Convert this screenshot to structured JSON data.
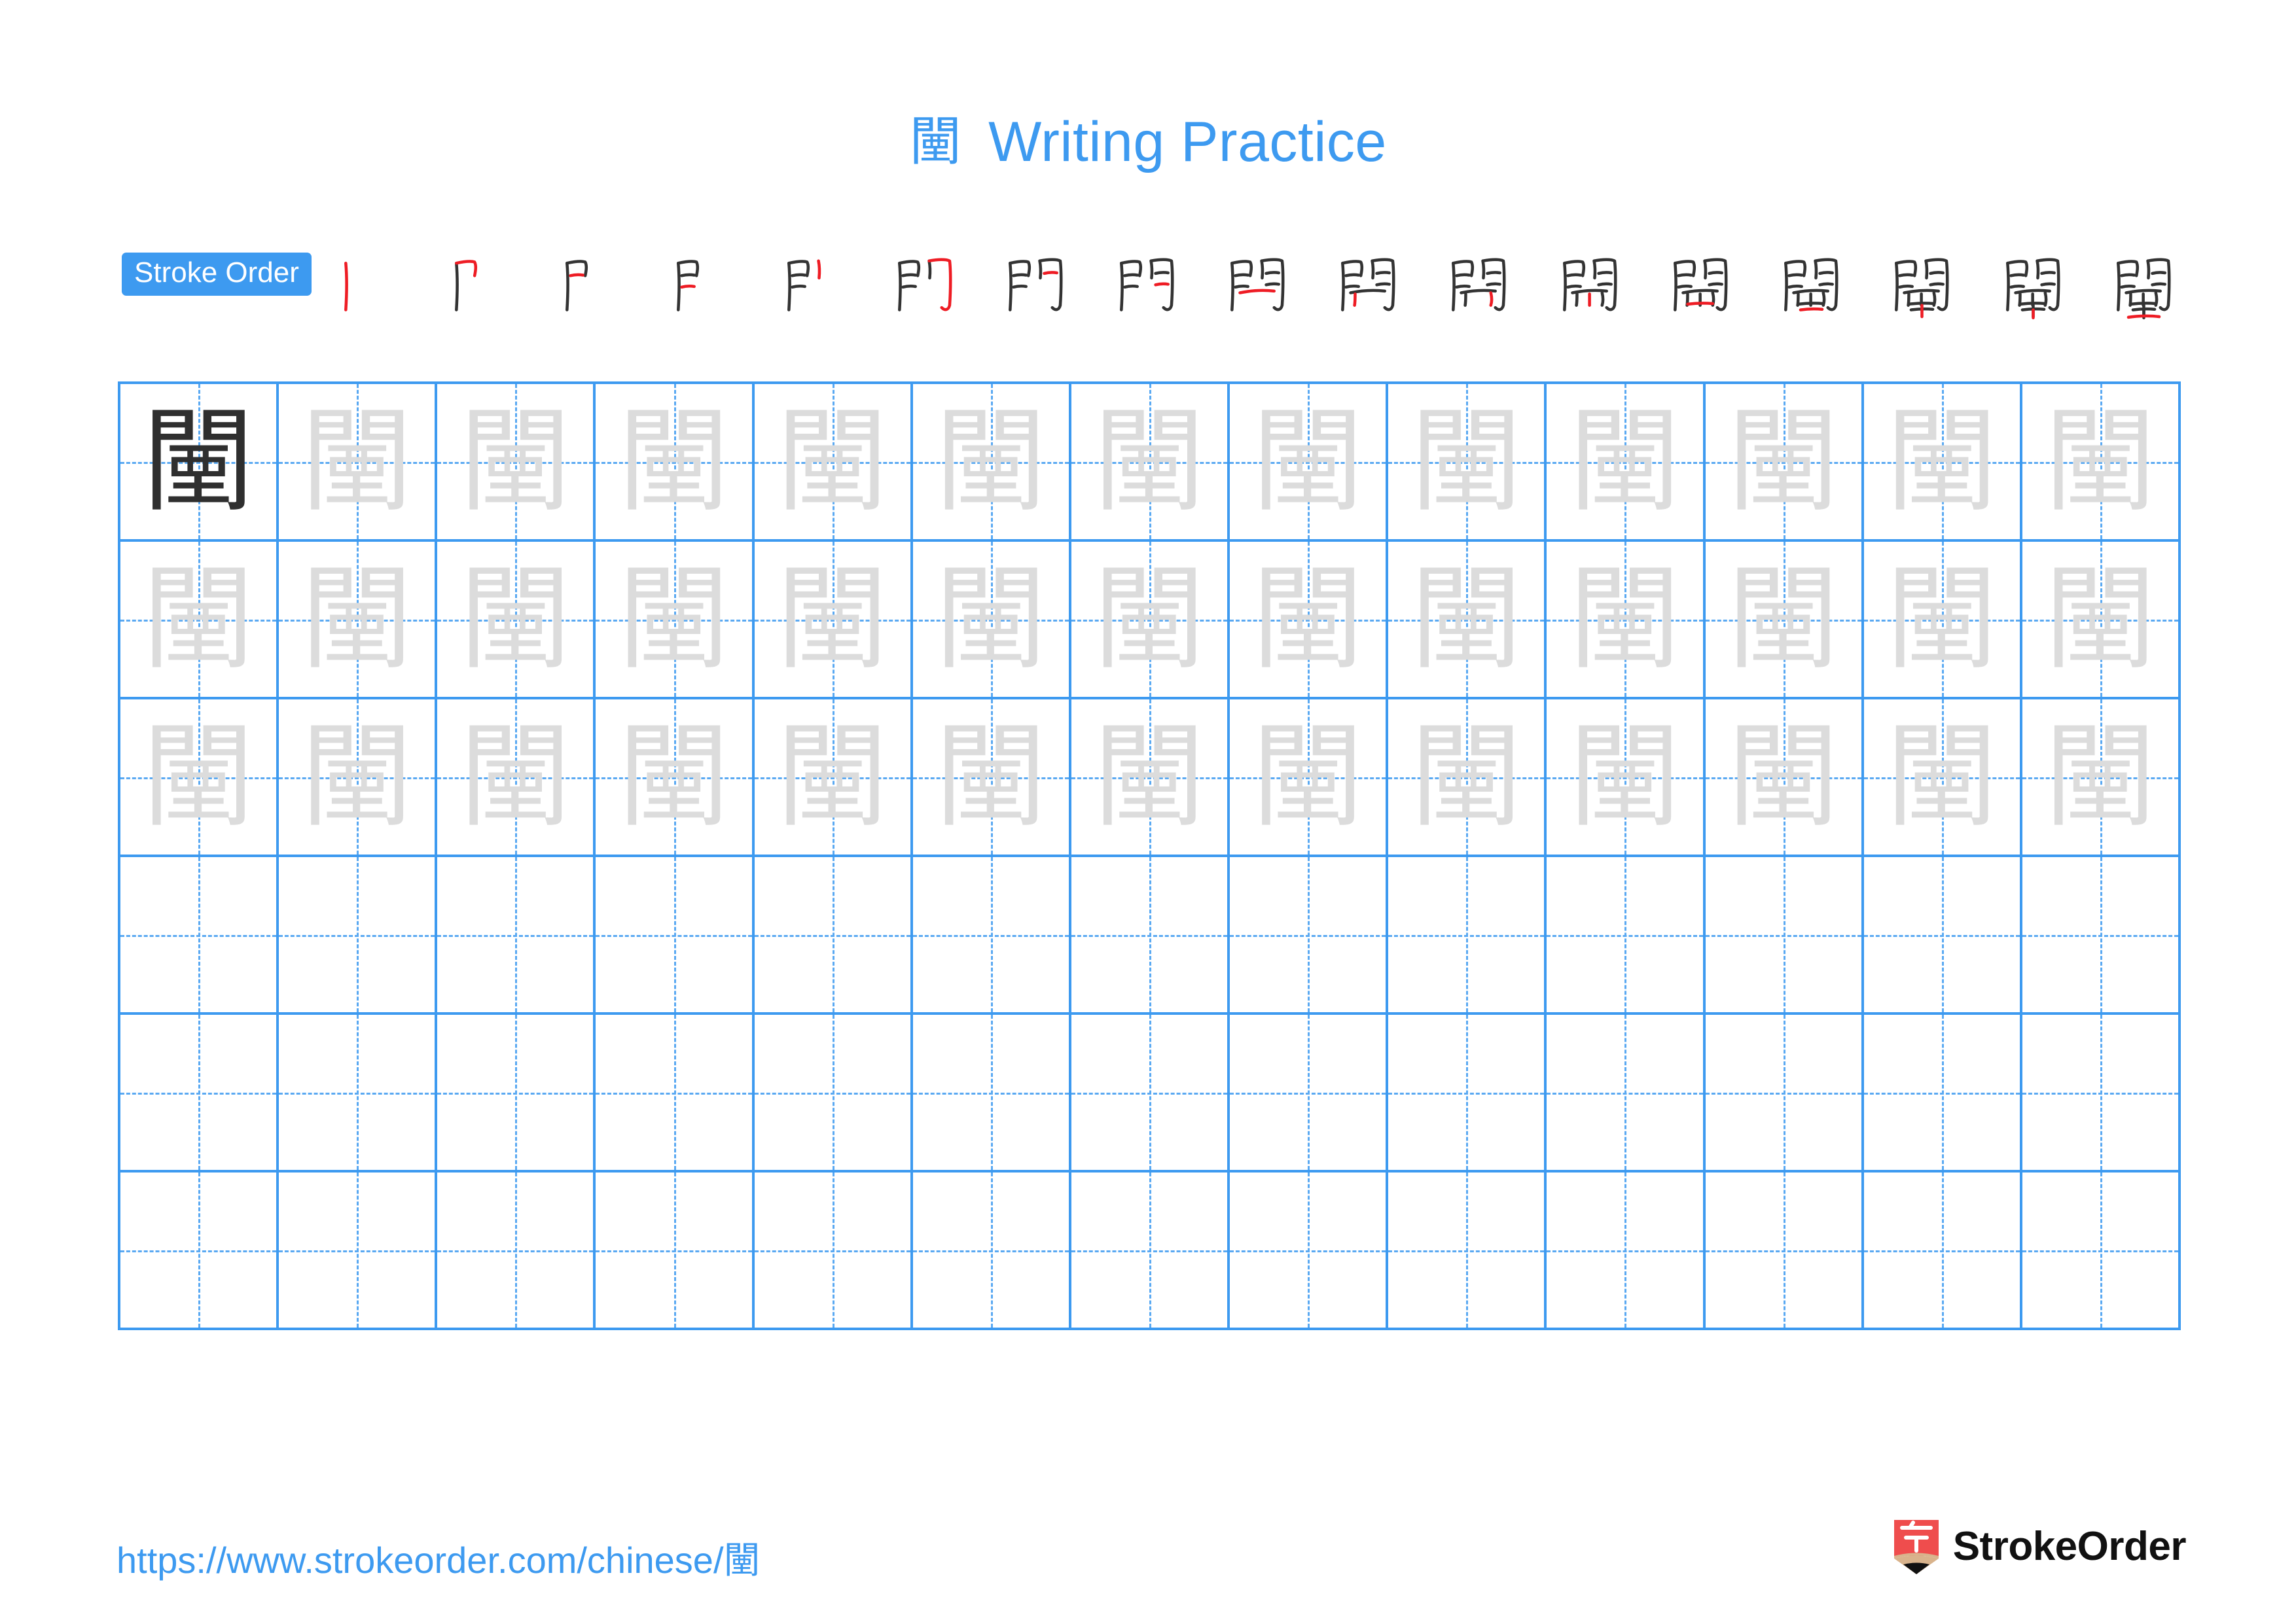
{
  "page": {
    "character": "闉",
    "title_suffix": " Writing Practice",
    "accent_color": "#3d9af0",
    "trace_color": "#dcdcdc",
    "dark_color": "#2f2f2f",
    "stroke_new_color": "#ee1c24",
    "stroke_old_color": "#333333"
  },
  "stroke_order": {
    "badge_label": "Stroke Order",
    "total_strokes": 17,
    "steps": [
      {
        "index": 1,
        "label": "stroke-1"
      },
      {
        "index": 2,
        "label": "stroke-2"
      },
      {
        "index": 3,
        "label": "stroke-3"
      },
      {
        "index": 4,
        "label": "stroke-4"
      },
      {
        "index": 5,
        "label": "stroke-5"
      },
      {
        "index": 6,
        "label": "stroke-6"
      },
      {
        "index": 7,
        "label": "stroke-7"
      },
      {
        "index": 8,
        "label": "stroke-8"
      },
      {
        "index": 9,
        "label": "stroke-9"
      },
      {
        "index": 10,
        "label": "stroke-10"
      },
      {
        "index": 11,
        "label": "stroke-11"
      },
      {
        "index": 12,
        "label": "stroke-12"
      },
      {
        "index": 13,
        "label": "stroke-13"
      },
      {
        "index": 14,
        "label": "stroke-14"
      },
      {
        "index": 15,
        "label": "stroke-15"
      },
      {
        "index": 16,
        "label": "stroke-16"
      },
      {
        "index": 17,
        "label": "stroke-17"
      }
    ]
  },
  "grid": {
    "columns": 13,
    "rows": 6,
    "filled_rows": 3,
    "first_cell_style": "dark",
    "cells": [
      [
        "闉",
        "闉",
        "闉",
        "闉",
        "闉",
        "闉",
        "闉",
        "闉",
        "闉",
        "闉",
        "闉",
        "闉",
        "闉"
      ],
      [
        "闉",
        "闉",
        "闉",
        "闉",
        "闉",
        "闉",
        "闉",
        "闉",
        "闉",
        "闉",
        "闉",
        "闉",
        "闉"
      ],
      [
        "闉",
        "闉",
        "闉",
        "闉",
        "闉",
        "闉",
        "闉",
        "闉",
        "闉",
        "闉",
        "闉",
        "闉",
        "闉"
      ],
      [
        "",
        "",
        "",
        "",
        "",
        "",
        "",
        "",
        "",
        "",
        "",
        "",
        ""
      ],
      [
        "",
        "",
        "",
        "",
        "",
        "",
        "",
        "",
        "",
        "",
        "",
        "",
        ""
      ],
      [
        "",
        "",
        "",
        "",
        "",
        "",
        "",
        "",
        "",
        "",
        "",
        "",
        ""
      ]
    ]
  },
  "footer": {
    "url_prefix": "https://www.strokeorder.com/chinese/",
    "url_char": "闉",
    "brand_name": "StrokeOrder",
    "brand_logo_char": "字",
    "brand_logo_color": "#ef4d4d",
    "brand_logo_tip_color": "#d9b38c"
  }
}
